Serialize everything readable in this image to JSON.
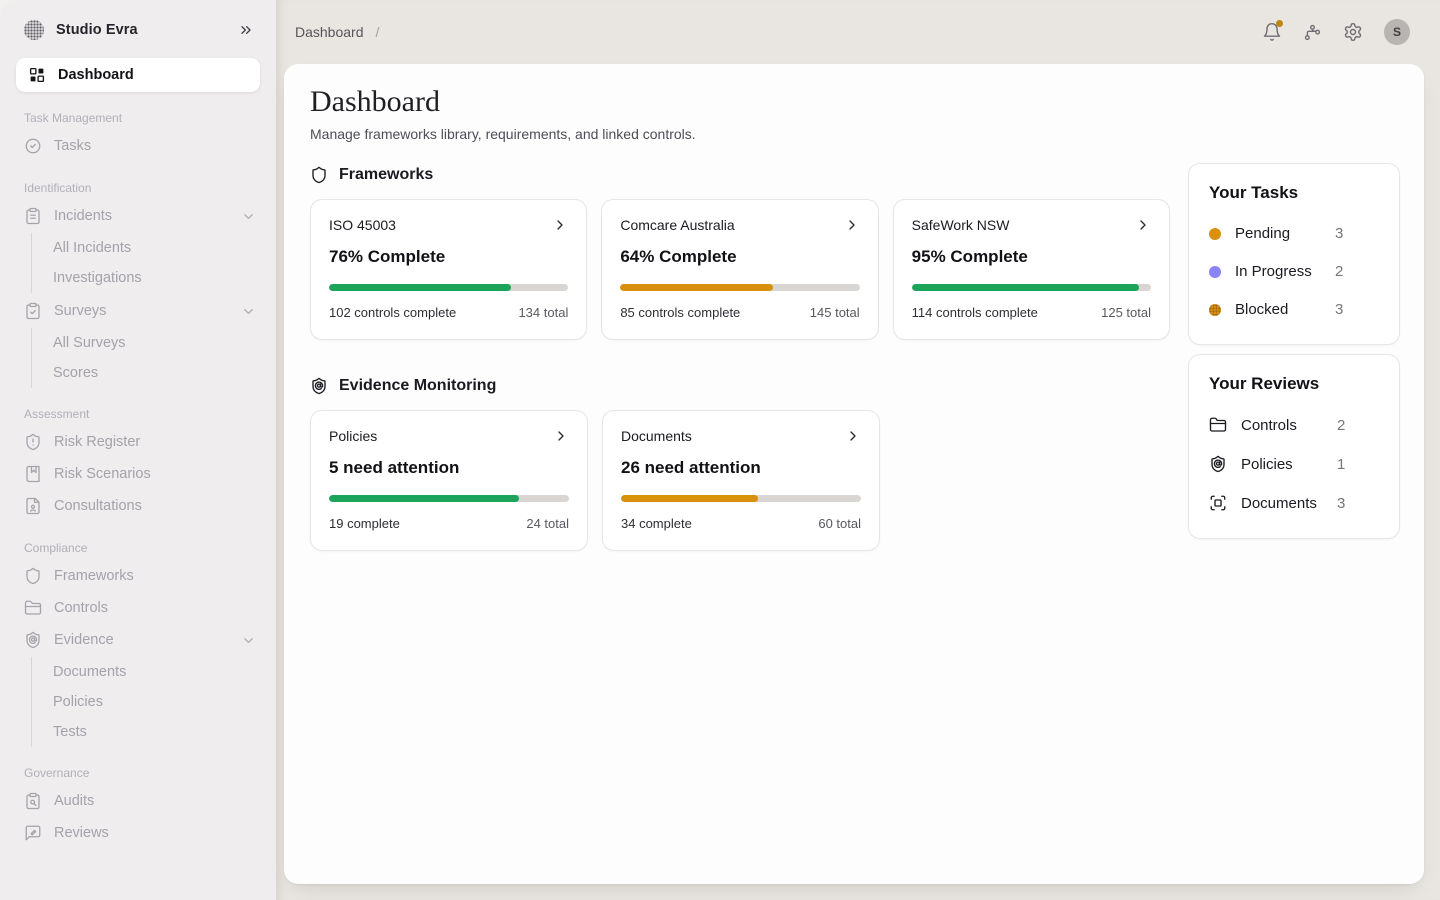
{
  "sidebar": {
    "logo_text": "Studio Evra",
    "active_item": "Dashboard",
    "sections": [
      {
        "label": "Task Management",
        "items": [
          {
            "label": "Tasks"
          }
        ]
      },
      {
        "label": "Identification",
        "items": [
          {
            "label": "Incidents",
            "children": [
              "All Incidents",
              "Investigations"
            ]
          },
          {
            "label": "Surveys",
            "children": [
              "All Surveys",
              "Scores"
            ]
          }
        ]
      },
      {
        "label": "Assessment",
        "items": [
          {
            "label": "Risk Register"
          },
          {
            "label": "Risk Scenarios"
          },
          {
            "label": "Consultations"
          }
        ]
      },
      {
        "label": "Compliance",
        "items": [
          {
            "label": "Frameworks"
          },
          {
            "label": "Controls"
          },
          {
            "label": "Evidence",
            "children": [
              "Documents",
              "Policies",
              "Tests"
            ]
          }
        ]
      },
      {
        "label": "Governance",
        "items": [
          {
            "label": "Audits"
          },
          {
            "label": "Reviews"
          }
        ]
      }
    ]
  },
  "topbar": {
    "breadcrumb": "Dashboard",
    "separator": "/",
    "avatar_initial": "S"
  },
  "page": {
    "title": "Dashboard",
    "subtitle": "Manage frameworks library, requirements, and linked controls."
  },
  "frameworks": {
    "section_title": "Frameworks",
    "cards": [
      {
        "name": "ISO 45003",
        "headline": "76% Complete",
        "percent": 76,
        "color": "#1BA45A",
        "left": "102 controls complete",
        "right": "134 total"
      },
      {
        "name": "Comcare Australia",
        "headline": "64% Complete",
        "percent": 64,
        "color": "#D9910D",
        "left": "85 controls complete",
        "right": "145 total"
      },
      {
        "name": "SafeWork NSW",
        "headline": "95% Complete",
        "percent": 95,
        "color": "#1BA45A",
        "left": "114 controls complete",
        "right": "125 total"
      }
    ]
  },
  "evidence": {
    "section_title": "Evidence Monitoring",
    "cards": [
      {
        "name": "Policies",
        "headline": "5 need attention",
        "percent": 79,
        "color": "#1BA45A",
        "left": "19 complete",
        "right": "24 total"
      },
      {
        "name": "Documents",
        "headline": "26 need attention",
        "percent": 57,
        "color": "#D9910D",
        "left": "34 complete",
        "right": "60 total"
      }
    ]
  },
  "your_tasks": {
    "title": "Your Tasks",
    "items": [
      {
        "label": "Pending",
        "count": "3",
        "color": "#D9910D",
        "textured": false
      },
      {
        "label": "In Progress",
        "count": "2",
        "color": "#8B83F8",
        "textured": false
      },
      {
        "label": "Blocked",
        "count": "3",
        "color": "#D28C12",
        "textured": true
      }
    ]
  },
  "your_reviews": {
    "title": "Your Reviews",
    "items": [
      {
        "label": "Controls",
        "count": "2"
      },
      {
        "label": "Policies",
        "count": "1"
      },
      {
        "label": "Documents",
        "count": "3"
      }
    ]
  }
}
